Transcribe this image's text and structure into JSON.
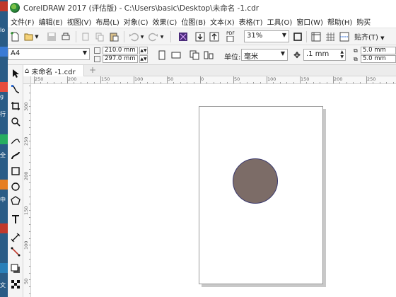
{
  "window": {
    "title": "CorelDRAW 2017 (评估版) - C:\\Users\\basic\\Desktop\\未命名 -1.cdr"
  },
  "menu": [
    "文件(F)",
    "编辑(E)",
    "视图(V)",
    "布局(L)",
    "对象(C)",
    "效果(C)",
    "位图(B)",
    "文本(X)",
    "表格(T)",
    "工具(O)",
    "窗口(W)",
    "帮助(H)",
    "购买"
  ],
  "toolbar": {
    "zoom_value": "31%",
    "snap_label": "贴齐(T)",
    "pdf_label": "PDF"
  },
  "property_bar": {
    "page_size": "A4",
    "width": "210.0 mm",
    "height": "297.0 mm",
    "units_label": "单位:",
    "units_value": "毫米",
    "nudge": ".1 mm",
    "dup_x": "5.0 mm",
    "dup_y": "5.0 mm"
  },
  "document_tab": {
    "label": "未命名 -1.cdr"
  },
  "ruler": {
    "h_labels": [
      "250",
      "200",
      "150",
      "100",
      "50",
      "0",
      "50",
      "100",
      "150",
      "200",
      "250"
    ],
    "v_labels": [
      "300",
      "250",
      "200",
      "150",
      "100",
      "50"
    ]
  },
  "desktop": {
    "labels": [
      "lo",
      "g",
      "行",
      "全",
      "中",
      "文"
    ]
  },
  "colors": {
    "ellipse_fill": "#7c6c67",
    "ellipse_outline": "#3b3a6e",
    "desktop_bg": "#2a5c86"
  }
}
